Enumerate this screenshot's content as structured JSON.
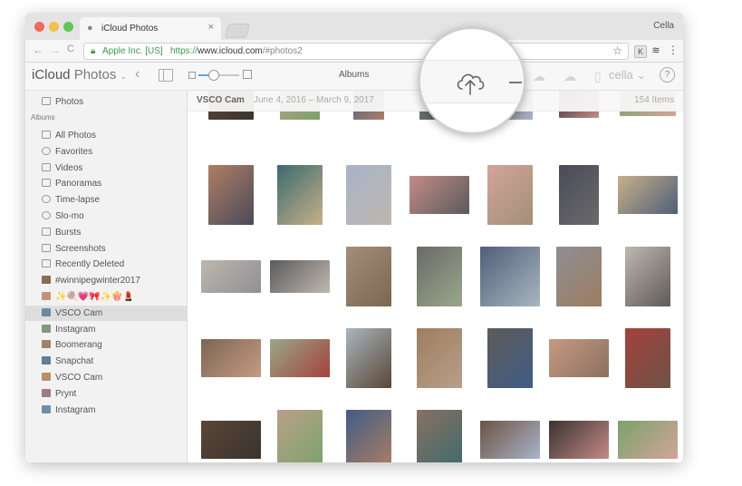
{
  "browser": {
    "tab_title": "iCloud Photos",
    "tab_close": "×",
    "user_name": "Cella",
    "secure_label": "Apple Inc. [US]",
    "url_scheme": "https://",
    "url_host": "www.icloud.com",
    "url_hash": "/#photos2",
    "nav_back": "←",
    "nav_forward": "→",
    "nav_reload": "C",
    "bookmark": "☆",
    "menu": "⋮"
  },
  "app": {
    "brand_bold": "iCloud",
    "brand_light": " Photos",
    "brand_chevron": "⌄",
    "view_title": "Albums",
    "account": "cella ⌄",
    "help": "?",
    "zoom_level": 0.35
  },
  "sidebar": {
    "top_item": "Photos",
    "section_label": "Albums",
    "items": [
      {
        "label": "All Photos",
        "icon": "photos-icon"
      },
      {
        "label": "Favorites",
        "icon": "heart-icon"
      },
      {
        "label": "Videos",
        "icon": "video-icon"
      },
      {
        "label": "Panoramas",
        "icon": "panorama-icon"
      },
      {
        "label": "Time-lapse",
        "icon": "timelapse-icon"
      },
      {
        "label": "Slo-mo",
        "icon": "slomo-icon"
      },
      {
        "label": "Bursts",
        "icon": "bursts-icon"
      },
      {
        "label": "Screenshots",
        "icon": "screenshot-icon"
      },
      {
        "label": "Recently Deleted",
        "icon": "trash-icon"
      },
      {
        "label": "#winnipegwinter2017",
        "icon": "album-thumb"
      },
      {
        "label": "✨🍭💗🎀✨🍿💄",
        "icon": "album-thumb"
      },
      {
        "label": "VSCO Cam",
        "icon": "album-thumb",
        "selected": true
      },
      {
        "label": "Instagram",
        "icon": "album-thumb"
      },
      {
        "label": "Boomerang",
        "icon": "album-thumb"
      },
      {
        "label": "Snapchat",
        "icon": "album-thumb"
      },
      {
        "label": "VSCO Cam",
        "icon": "album-thumb"
      },
      {
        "label": "Prynt",
        "icon": "album-thumb"
      },
      {
        "label": "Instagram",
        "icon": "album-thumb"
      }
    ]
  },
  "content": {
    "album_name": "VSCO Cam",
    "date_range": "June 4, 2016 – March 9, 2017",
    "item_count": "154 Items"
  },
  "colors": {
    "accent": "#5fa3e3",
    "secure_green": "#3c9a48",
    "selected_row": "#dedede"
  }
}
